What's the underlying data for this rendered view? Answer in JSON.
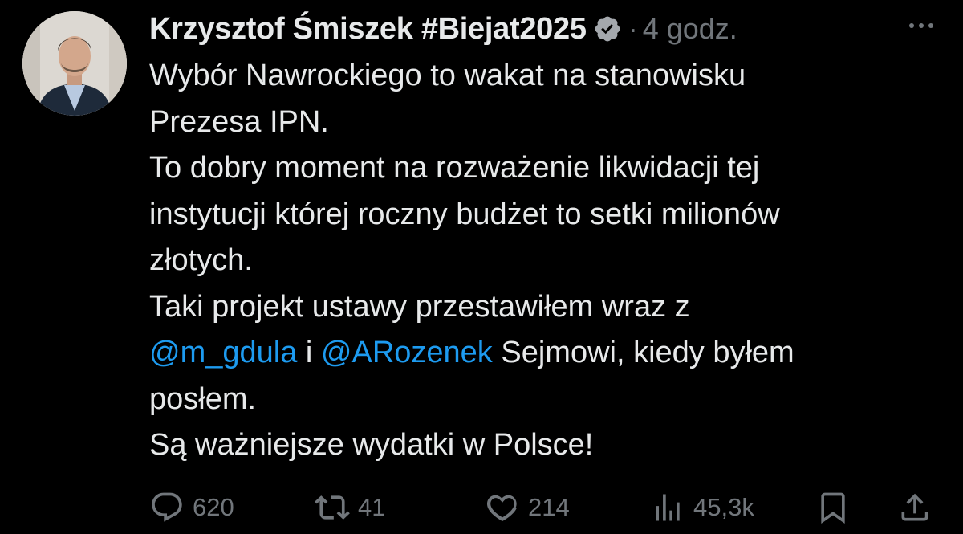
{
  "author": {
    "name": "Krzysztof Śmiszek #Biejat2025",
    "verified": true
  },
  "meta": {
    "separator": "·",
    "time": "4 godz."
  },
  "tweet": {
    "lines": [
      "Wybór Nawrockiego to wakat na stanowisku",
      "Prezesa IPN.",
      "To dobry moment na rozważenie likwidacji tej",
      "instytucji której roczny budżet to setki milionów",
      "złotych.",
      "Taki projekt ustawy przestawiłem wraz z"
    ],
    "mention1": "@m_gdula",
    "joiner": " i ",
    "mention2": "@ARozenek",
    "after_mentions": " Sejmowi, kiedy byłem",
    "line8": "posłem.",
    "line9": "Są ważniejsze wydatki w Polsce!"
  },
  "actions": {
    "replies": "620",
    "retweets": "41",
    "likes": "214",
    "views": "45,3k"
  },
  "icons": {
    "verified": "verified-badge-icon",
    "more": "more-dots-icon",
    "reply": "reply-icon",
    "retweet": "retweet-icon",
    "like": "heart-icon",
    "views": "views-bar-chart-icon",
    "bookmark": "bookmark-icon",
    "share": "share-icon"
  },
  "colors": {
    "background": "#000000",
    "text": "#e7e9ea",
    "muted": "#71767b",
    "link": "#1d9bf0"
  }
}
